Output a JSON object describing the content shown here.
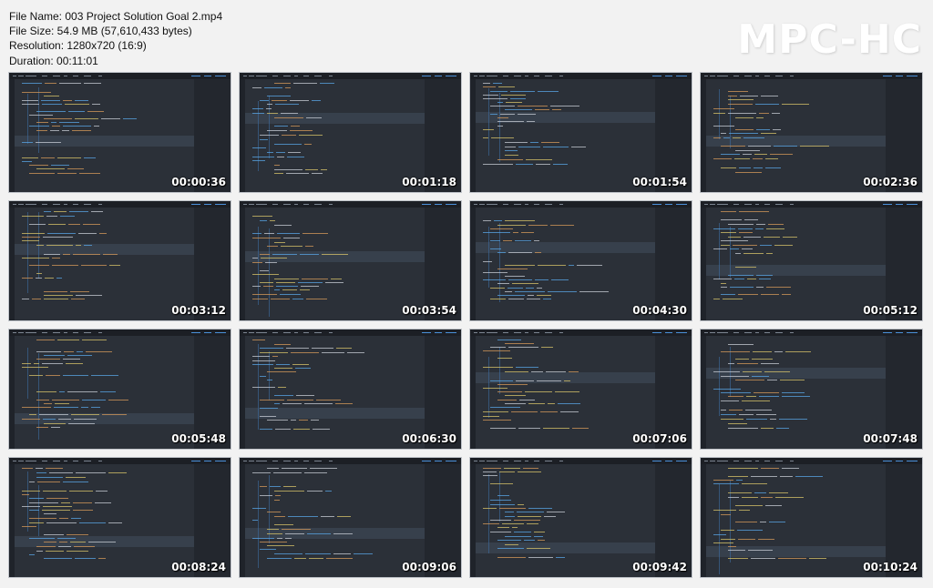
{
  "header": {
    "file_name": "File Name: 003 Project Solution Goal 2.mp4",
    "file_size": "File Size: 54.9 MB (57,610,433 bytes)",
    "resolution": "Resolution: 1280x720 (16:9)",
    "duration": "Duration: 00:11:01"
  },
  "logo": "MPC-HC",
  "thumbnails": [
    {
      "timestamp": "00:00:36"
    },
    {
      "timestamp": "00:01:18"
    },
    {
      "timestamp": "00:01:54"
    },
    {
      "timestamp": "00:02:36"
    },
    {
      "timestamp": "00:03:12"
    },
    {
      "timestamp": "00:03:54"
    },
    {
      "timestamp": "00:04:30"
    },
    {
      "timestamp": "00:05:12"
    },
    {
      "timestamp": "00:05:48"
    },
    {
      "timestamp": "00:06:30"
    },
    {
      "timestamp": "00:07:06"
    },
    {
      "timestamp": "00:07:48"
    },
    {
      "timestamp": "00:08:24"
    },
    {
      "timestamp": "00:09:06"
    },
    {
      "timestamp": "00:09:42"
    },
    {
      "timestamp": "00:10:24"
    }
  ],
  "colors": {
    "background": "#f2f2f2",
    "frame": "#262a33",
    "code_blue": "#5aa6e6",
    "code_yellow": "#d9c46a",
    "code_white": "#c9ced6",
    "code_orange": "#d79a5a"
  }
}
